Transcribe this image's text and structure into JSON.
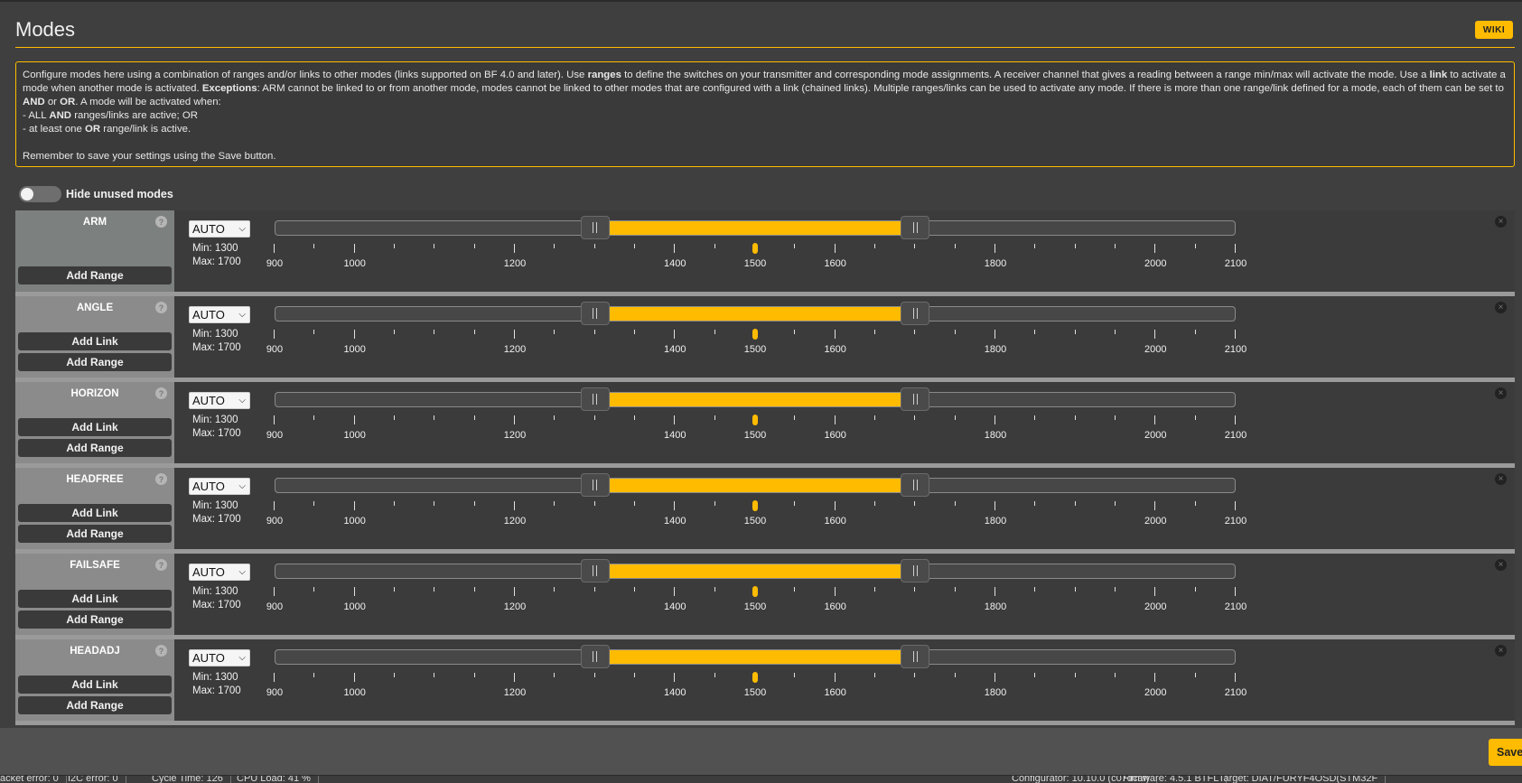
{
  "page": {
    "title": "Modes",
    "wiki_label": "WIKI"
  },
  "note": {
    "line1_a": "Configure modes here using a combination of ranges and/or links to other modes (links supported on BF 4.0 and later). Use ",
    "line1_b": "ranges",
    "line1_c": " to define the switches on your transmitter and corresponding mode assignments. A receiver channel that gives a reading between a range min/max will activate the mode. Use a ",
    "line1_d": "link",
    "line1_e": " to activate a mode when another mode is activated. ",
    "line1_f": "Exceptions",
    "line1_g": ": ARM cannot be linked to or from another mode, modes cannot be linked to other modes that are configured with a link (chained links). Multiple ranges/links can be used to activate any mode. If there is more than one range/link defined for a mode, each of them can be set to ",
    "line1_h": "AND",
    "line1_i": " or ",
    "line1_j": "OR",
    "line1_k": ". A mode will be activated when:",
    "line2_a": "- ALL ",
    "line2_b": "AND",
    "line2_c": " ranges/links are active; OR",
    "line3_a": "- at least one ",
    "line3_b": "OR",
    "line3_c": " range/link is active.",
    "line4": "Remember to save your settings using the Save button."
  },
  "toggle": {
    "label": "Hide unused modes",
    "on": false
  },
  "range": {
    "min_value": 1300,
    "max_value": 1700,
    "channel_value": 1500,
    "scale_min": 900,
    "scale_max": 2100,
    "tick_labels": [
      "900",
      "1000",
      "1200",
      "1400",
      "1500",
      "1600",
      "1800",
      "2000",
      "2100"
    ],
    "min_text": "Min: 1300",
    "max_text": "Max: 1700",
    "channel_select": "AUTO"
  },
  "buttons": {
    "add_link": "Add Link",
    "add_range": "Add Range",
    "help_glyph": "?",
    "close_glyph": "×"
  },
  "modes": [
    {
      "name": "ARM"
    },
    {
      "name": "ANGLE"
    },
    {
      "name": "HORIZON"
    },
    {
      "name": "HEADFREE"
    },
    {
      "name": "FAILSAFE"
    },
    {
      "name": "HEADADJ"
    }
  ],
  "footer": {
    "save_label": "Save",
    "status": [
      "acket error: 0",
      "I2C error: 0",
      "Cycle Time: 126",
      "CPU Load: 41 %",
      "Configurator: 10.10.0 (c07dcaf)",
      "Firmware: 4.5.1 BTFL",
      "Target: DIAT/FURYF4OSD(STM32F"
    ]
  },
  "colors": {
    "accent": "#ffbb00"
  }
}
